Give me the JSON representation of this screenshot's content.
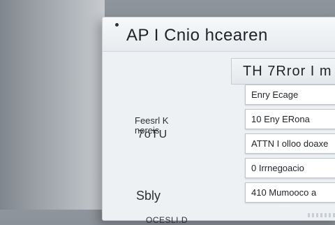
{
  "window": {
    "title": "AP I Cnio hcearen"
  },
  "left_panel": {
    "label_a": "Feesrl K\nnoreis",
    "label_b": "7oTU",
    "label_c": "Sbly",
    "label_d": "OCESLI.D"
  },
  "panel": {
    "header": "TH 7Rror I m"
  },
  "list": {
    "items": [
      "Enry Ecage",
      "10 Eny ERona",
      "ATTN I olloo doaxe",
      "0 Irrnegoacio",
      "410 Mumooco a"
    ]
  }
}
